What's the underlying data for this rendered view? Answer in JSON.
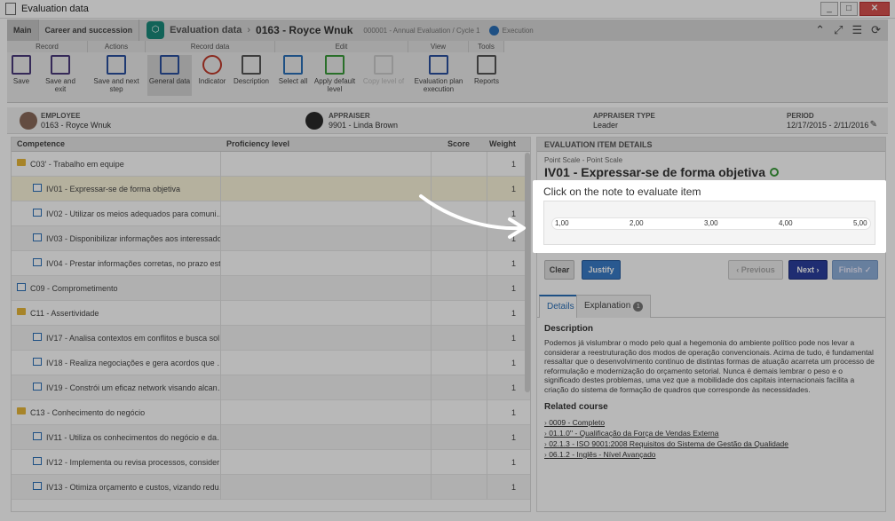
{
  "window": {
    "title": "Evaluation data"
  },
  "header": {
    "tabs": [
      {
        "label": "Main"
      },
      {
        "label": "Career and succession"
      }
    ],
    "crumb": "Evaluation data",
    "crumb_main": "0163 - Royce Wnuk",
    "meta": "000001 - Annual Evaluation / Cycle 1",
    "status": "Execution"
  },
  "ribbon": {
    "groups": [
      "Record",
      "Actions",
      "Record data",
      "Edit",
      "View",
      "Tools"
    ],
    "buttons": {
      "save": "Save",
      "save_exit": "Save and exit",
      "save_next": "Save and next step",
      "general": "General data",
      "indicator": "Indicator",
      "description": "Description",
      "select_all": "Select all",
      "apply_default": "Apply default level",
      "copy_level": "Copy level of",
      "eval_plan": "Evaluation plan execution",
      "reports": "Reports"
    }
  },
  "employee": {
    "employee_label": "EMPLOYEE",
    "employee_value": "0163 - Royce Wnuk",
    "appraiser_label": "APPRAISER",
    "appraiser_value": "9901 - Linda Brown",
    "type_label": "APPRAISER TYPE",
    "type_value": "Leader",
    "period_label": "PERIOD",
    "period_value": "12/17/2015 - 2/11/2016"
  },
  "grid": {
    "headers": {
      "competence": "Competence",
      "proficiency": "Proficiency level",
      "score": "Score",
      "weight": "Weight"
    },
    "rows": [
      {
        "label": "C03' - Trabalho em equipe",
        "weight": "1",
        "kind": "folder",
        "indent": 0
      },
      {
        "label": "IV01 - Expressar-se de forma objetiva",
        "weight": "1",
        "kind": "item",
        "indent": 1
      },
      {
        "label": "IV02 - Utilizar os meios adequados para comuni…",
        "weight": "1",
        "kind": "item",
        "indent": 1
      },
      {
        "label": "IV03 - Disponibilizar informações aos interessados",
        "weight": "1",
        "kind": "item",
        "indent": 1
      },
      {
        "label": "IV04 - Prestar informações corretas, no prazo est…",
        "weight": "1",
        "kind": "item",
        "indent": 1
      },
      {
        "label": "C09 - Comprometimento",
        "weight": "1",
        "kind": "item",
        "indent": 0
      },
      {
        "label": "C11 - Assertividade",
        "weight": "1",
        "kind": "folder",
        "indent": 0
      },
      {
        "label": "IV17 - Analisa contextos em conflitos e busca sol…",
        "weight": "1",
        "kind": "item",
        "indent": 1
      },
      {
        "label": "IV18 - Realiza negociações e gera acordos que …",
        "weight": "1",
        "kind": "item",
        "indent": 1
      },
      {
        "label": "IV19 - Constrói um eficaz network visando alcan…",
        "weight": "1",
        "kind": "item",
        "indent": 1
      },
      {
        "label": "C13 - Conhecimento do negócio",
        "weight": "1",
        "kind": "folder",
        "indent": 0
      },
      {
        "label": "IV11 - Utiliza os conhecimentos do negócio e da…",
        "weight": "1",
        "kind": "item",
        "indent": 1
      },
      {
        "label": "IV12 - Implementa ou revisa processos, consider…",
        "weight": "1",
        "kind": "item",
        "indent": 1
      },
      {
        "label": "IV13 - Otimiza orçamento e custos, vizando redu…",
        "weight": "1",
        "kind": "item",
        "indent": 1
      }
    ]
  },
  "details": {
    "header": "EVALUATION ITEM DETAILS",
    "scale_caption": "Point Scale - Point Scale",
    "item_title": "IV01 - Expressar-se de forma objetiva",
    "eval_caption": "Click on the note to evaluate item",
    "scale": [
      "1,00",
      "2,00",
      "3,00",
      "4,00",
      "5,00"
    ],
    "buttons": {
      "clear": "Clear",
      "justify": "Justify",
      "previous": "Previous",
      "next": "Next",
      "finish": "Finish"
    },
    "tabs": {
      "details": "Details",
      "explanation": "Explanation",
      "badge": "1"
    },
    "description_title": "Description",
    "description": "Podemos já vislumbrar o modo pelo qual a hegemonia do ambiente político pode nos levar a considerar a reestruturação dos modos de operação convencionais. Acima de tudo, é fundamental ressaltar que o desenvolvimento contínuo de distintas formas de atuação acarreta um processo de reformulação e modernização do orçamento setorial. Nunca é demais lembrar o peso e o significado destes problemas, uma vez que a mobilidade dos capitais internacionais facilita a criação do sistema de formação de quadros que corresponde às necessidades.",
    "related_title": "Related course",
    "courses": [
      "0009 - Completo",
      "01.1.0'' - Qualificação da Força de Vendas Externa",
      "02.1.3 - ISO 9001:2008 Requisitos do Sistema de Gestão da Qualidade",
      "06.1.2 - Inglês - Nível Avançado"
    ]
  }
}
